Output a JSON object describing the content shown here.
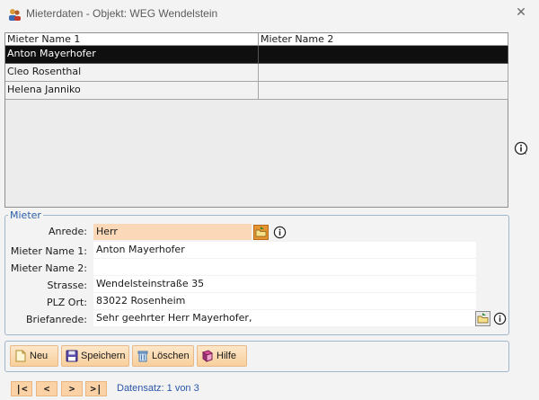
{
  "window": {
    "title": "Mieterdaten - Objekt: WEG Wendelstein",
    "close_glyph": "✕"
  },
  "grid": {
    "columns": [
      "Mieter Name 1",
      "Mieter Name 2"
    ],
    "rows": [
      {
        "name1": "Anton Mayerhofer",
        "name2": "",
        "selected": true
      },
      {
        "name1": "Cleo Rosenthal",
        "name2": "",
        "selected": false
      },
      {
        "name1": "Helena Janniko",
        "name2": "",
        "selected": false
      }
    ]
  },
  "form": {
    "legend": "Mieter",
    "anrede": {
      "label": "Anrede:",
      "value": "Herr"
    },
    "name1": {
      "label": "Mieter Name 1:",
      "value": "Anton Mayerhofer"
    },
    "name2": {
      "label": "Mieter Name 2:",
      "value": ""
    },
    "strasse": {
      "label": "Strasse:",
      "value": "Wendelsteinstraße 35"
    },
    "plz_ort": {
      "label": "PLZ Ort:",
      "value": "83022 Rosenheim"
    },
    "briefanrede": {
      "label": "Briefanrede:",
      "value": "Sehr geehrter Herr Mayerhofer,"
    }
  },
  "toolbar": {
    "new_label": "Neu",
    "save_label": "Speichern",
    "delete_label": "Löschen",
    "help_label": "Hilfe"
  },
  "navigator": {
    "first": "|<",
    "prev": "<",
    "next": ">",
    "last": ">|",
    "record_text": "Datensatz: 1 von 3"
  },
  "colors": {
    "selected_row_bg": "#0f0f0f",
    "anrede_field_bg": "#fbd9b8",
    "button_bg": "#f8cf9b",
    "group_border": "#9fb6cc",
    "legend_text": "#2a5ea8",
    "nav_text": "#2a55a8"
  },
  "icons": {
    "app": "users-icon",
    "lookup": "folder-lookup-icon",
    "info": "info-icon",
    "new": "new-document-icon",
    "save": "save-disk-icon",
    "delete": "trash-icon",
    "help": "help-book-icon"
  }
}
